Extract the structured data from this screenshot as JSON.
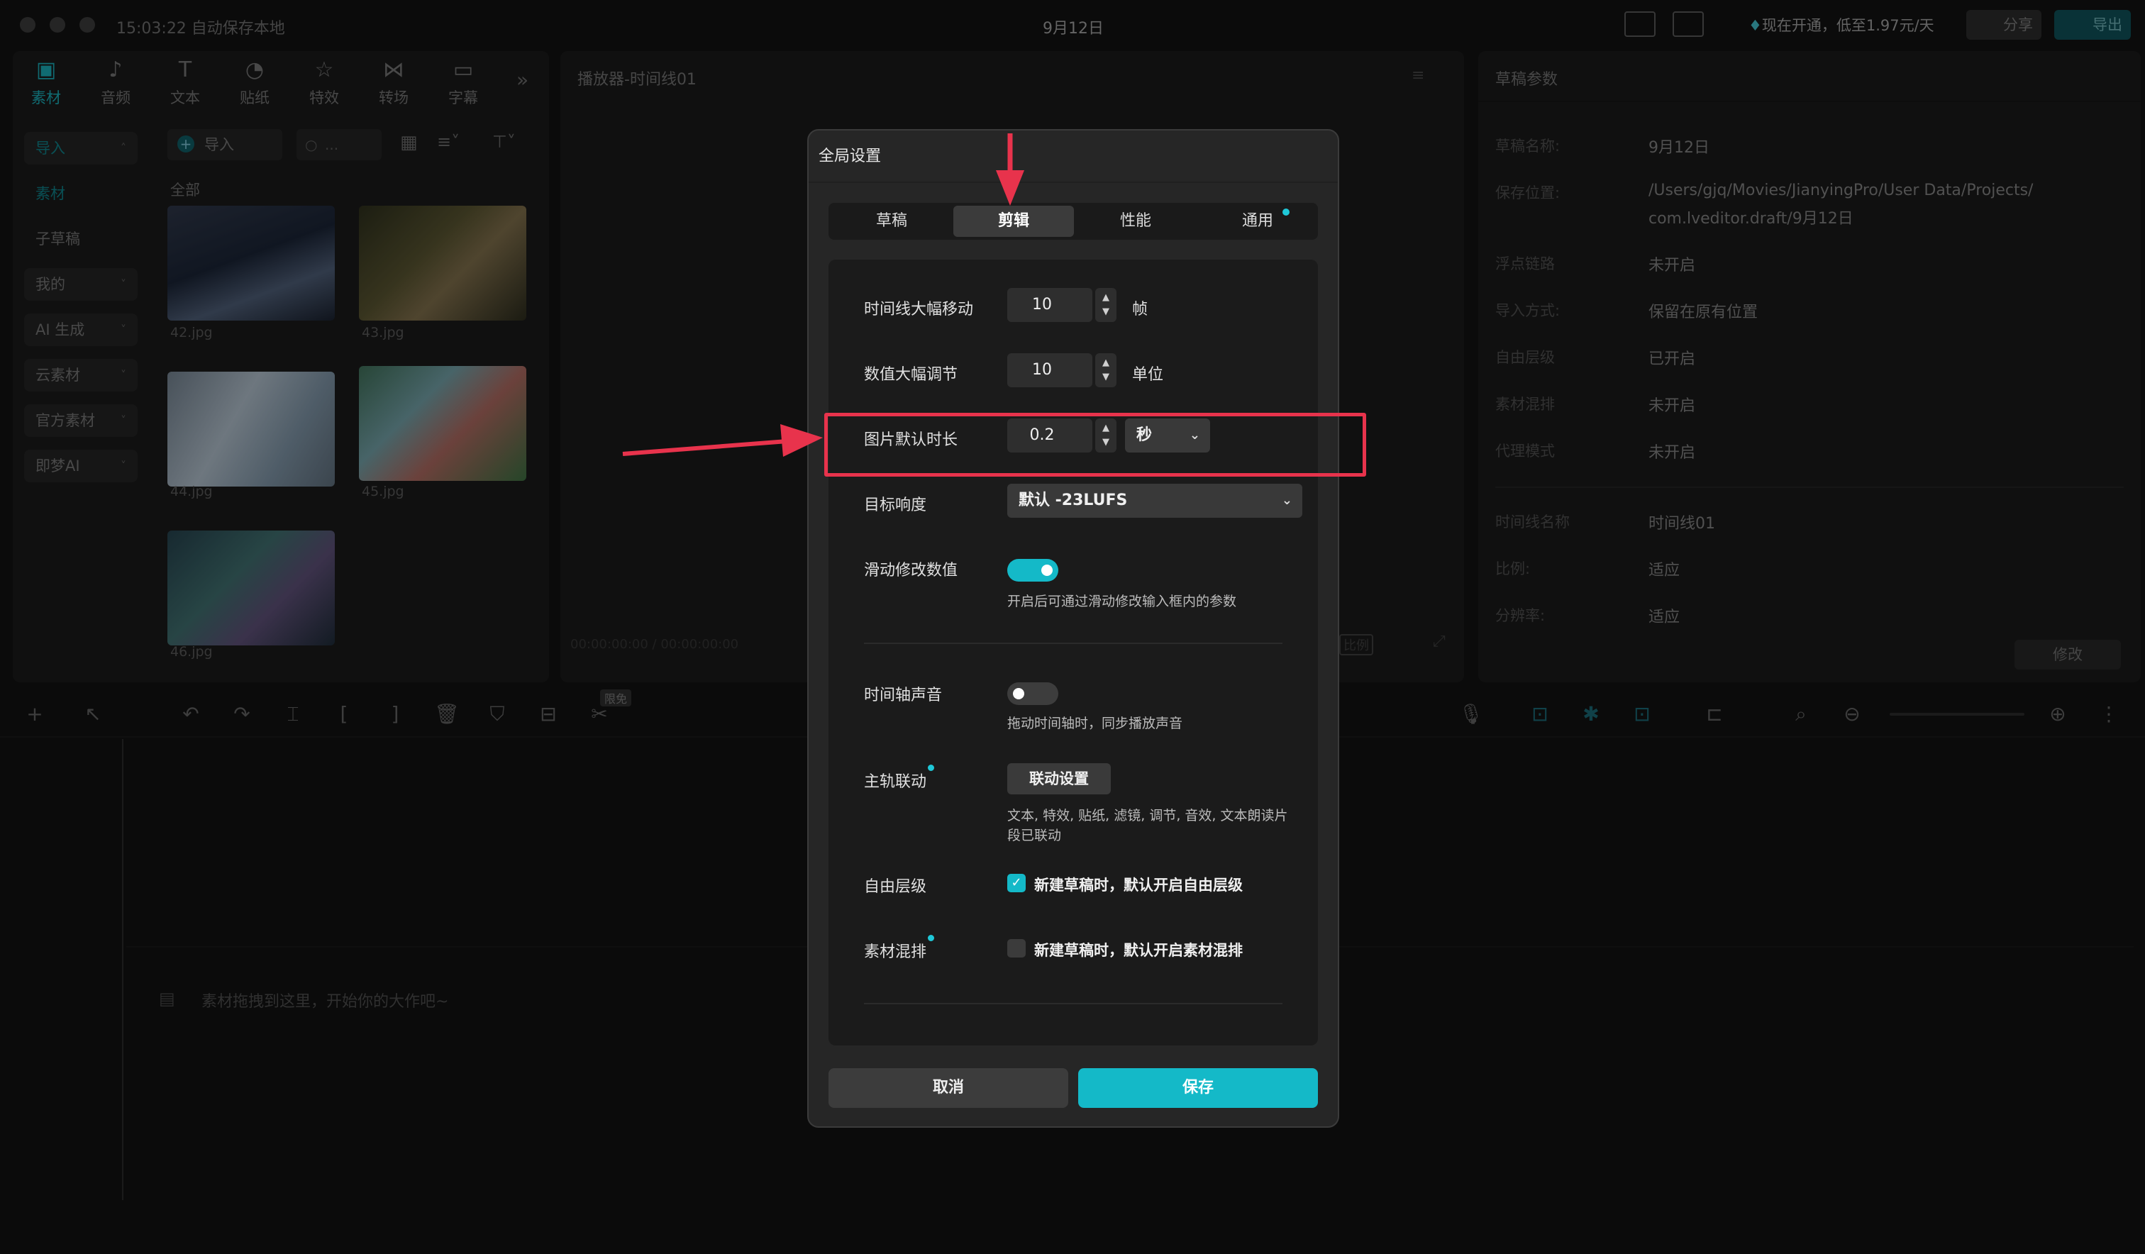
{
  "titlebar": {
    "autosave": "15:03:22 自动保存本地",
    "project_name": "9月12日",
    "vip_text": "现在开通，低至1.97元/天",
    "share_label": "分享",
    "export_label": "导出"
  },
  "media_tabs": [
    {
      "label": "素材",
      "icon": "media-icon"
    },
    {
      "label": "音频",
      "icon": "audio-icon"
    },
    {
      "label": "文本",
      "icon": "text-icon"
    },
    {
      "label": "贴纸",
      "icon": "sticker-icon"
    },
    {
      "label": "特效",
      "icon": "effects-icon"
    },
    {
      "label": "转场",
      "icon": "transition-icon"
    },
    {
      "label": "字幕",
      "icon": "subtitle-icon"
    }
  ],
  "sidebar": [
    {
      "label": "导入"
    },
    {
      "label": "素材"
    },
    {
      "label": "子草稿"
    },
    {
      "label": "我的"
    },
    {
      "label": "AI 生成"
    },
    {
      "label": "云素材"
    },
    {
      "label": "官方素材"
    },
    {
      "label": "即梦AI"
    }
  ],
  "media": {
    "import_label": "导入",
    "search_placeholder": "...",
    "section_label": "全部",
    "items": [
      {
        "name": "42.jpg"
      },
      {
        "name": "43.jpg"
      },
      {
        "name": "44.jpg"
      },
      {
        "name": "45.jpg"
      },
      {
        "name": "46.jpg"
      }
    ]
  },
  "player": {
    "title": "播放器-时间线01",
    "timecode": "00:00:00:00 / 00:00:00:00",
    "ratio_label": "比例"
  },
  "draft_params": {
    "title": "草稿参数",
    "rows": [
      {
        "label": "草稿名称:",
        "value": "9月12日"
      },
      {
        "label": "保存位置:",
        "value": "/Users/gjq/Movies/JianyingPro/User Data/Projects/",
        "value2": "com.lveditor.draft/9月12日"
      },
      {
        "label": "浮点链路",
        "value": "未开启"
      },
      {
        "label": "导入方式:",
        "value": "保留在原有位置"
      },
      {
        "label": "自由层级",
        "value": "已开启"
      },
      {
        "label": "素材混排",
        "value": "未开启"
      },
      {
        "label": "代理模式",
        "value": "未开启"
      },
      {
        "label": "时间线名称",
        "value": "时间线01"
      },
      {
        "label": "比例:",
        "value": "适应"
      },
      {
        "label": "分辨率:",
        "value": "适应"
      }
    ],
    "modify_label": "修改"
  },
  "timeline": {
    "badge": "限免",
    "empty_hint": "素材拖拽到这里，开始你的大作吧~"
  },
  "dialog": {
    "title": "全局设置",
    "tabs": [
      "草稿",
      "剪辑",
      "性能",
      "通用"
    ],
    "active_tab": "剪辑",
    "rows": {
      "timeline_jump": {
        "label": "时间线大幅移动",
        "value": "10",
        "unit": "帧"
      },
      "value_jump": {
        "label": "数值大幅调节",
        "value": "10",
        "unit": "单位"
      },
      "image_duration": {
        "label": "图片默认时长",
        "value": "0.2",
        "unit_select": "秒"
      },
      "loudness": {
        "label": "目标响度",
        "select": "默认 -23LUFS"
      },
      "drag_modify": {
        "label": "滑动修改数值",
        "enabled": true,
        "hint": "开启后可通过滑动修改输入框内的参数"
      },
      "timeline_audio": {
        "label": "时间轴声音",
        "enabled": false,
        "hint": "拖动时间轴时，同步播放声音"
      },
      "main_track_link": {
        "label": "主轨联动",
        "button": "联动设置",
        "hint1": "文本, 特效, 贴纸, 滤镜, 调节, 音效, 文本朗读片",
        "hint2": "段已联动"
      },
      "free_layer": {
        "label": "自由层级",
        "checked": true,
        "check_label": "新建草稿时，默认开启自由层级"
      },
      "material_mix": {
        "label": "素材混排",
        "checked": false,
        "check_label": "新建草稿时，默认开启素材混排"
      }
    },
    "cancel_label": "取消",
    "save_label": "保存"
  },
  "colors": {
    "accent": "#14b9c8",
    "annotation": "#e8334c"
  }
}
